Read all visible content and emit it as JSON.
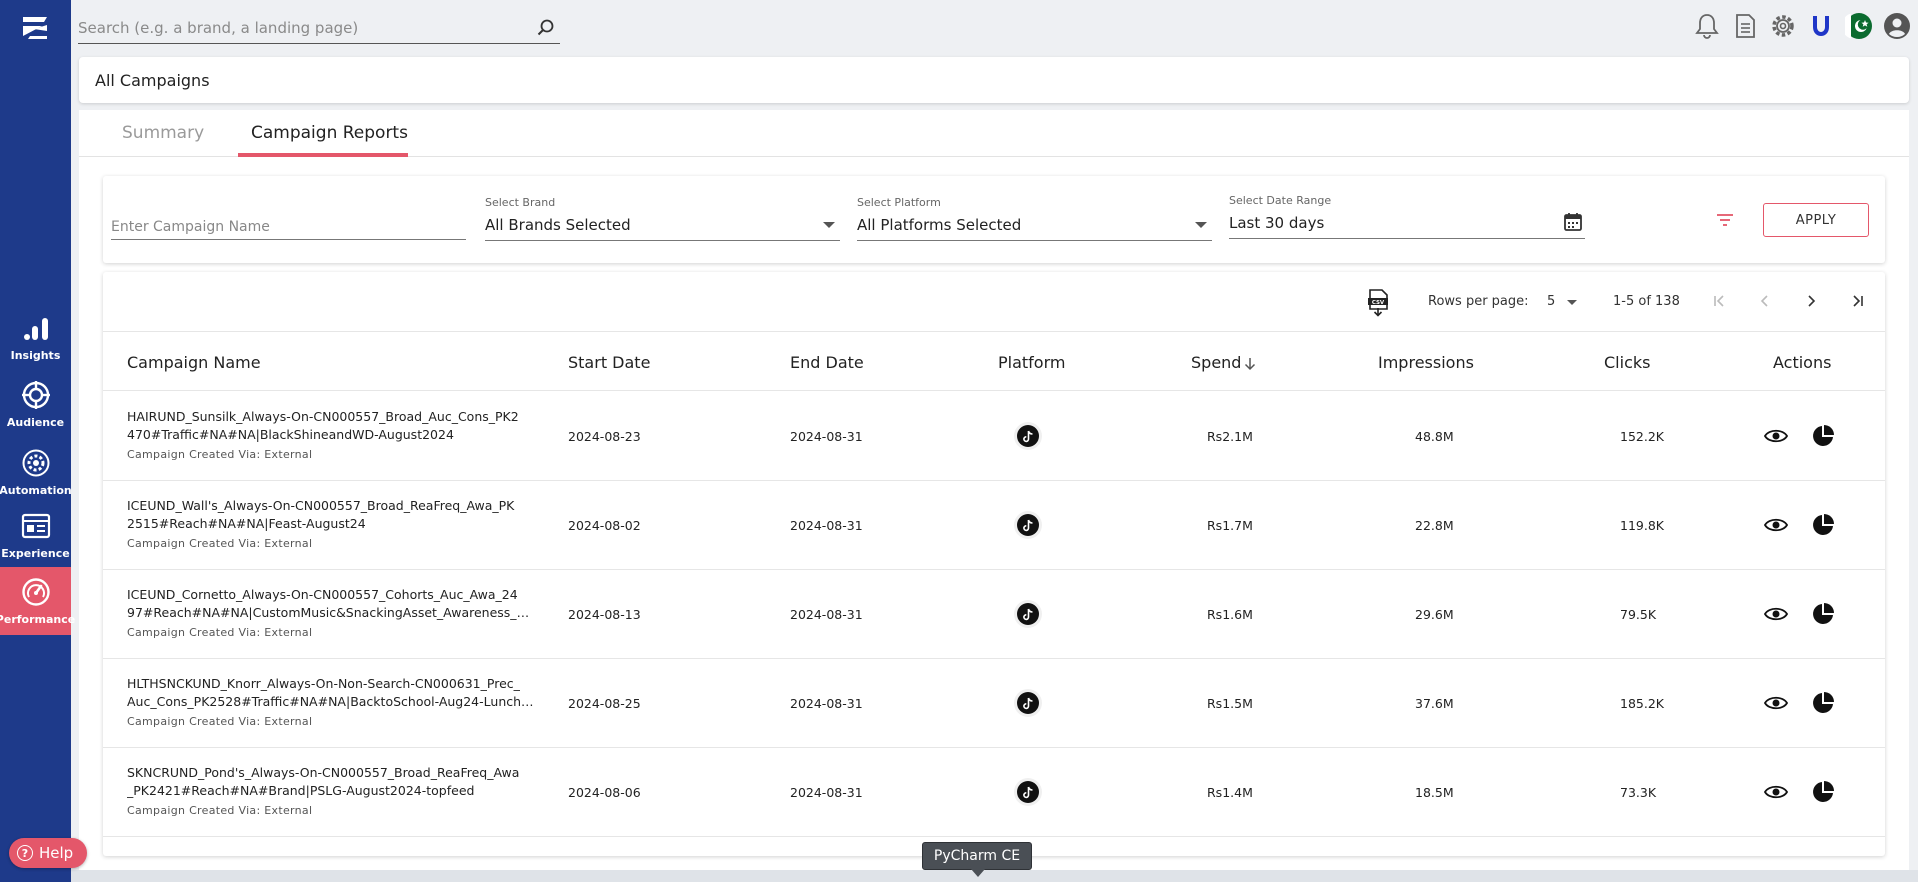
{
  "sidebar": {
    "items": [
      {
        "label": "Insights",
        "icon": "bar-chart-icon"
      },
      {
        "label": "Audience",
        "icon": "target-icon"
      },
      {
        "label": "Automation",
        "icon": "gear-icon"
      },
      {
        "label": "Experience",
        "icon": "newspaper-icon"
      },
      {
        "label": "Performance",
        "icon": "speedometer-icon",
        "active": true
      }
    ],
    "help_label": "Help"
  },
  "topbar": {
    "search_placeholder": "Search (e.g. a brand, a landing page)",
    "icons": [
      "bell-icon",
      "document-icon",
      "settings-icon",
      "unilever-logo-icon",
      "pakistan-flag-icon",
      "account-icon"
    ]
  },
  "header": {
    "title": "All Campaigns"
  },
  "tabs": [
    {
      "label": "Summary",
      "active": false
    },
    {
      "label": "Campaign Reports",
      "active": true
    }
  ],
  "filters": {
    "campaign_placeholder": "Enter Campaign Name",
    "brand": {
      "label": "Select Brand",
      "value": "All Brands Selected"
    },
    "platform": {
      "label": "Select Platform",
      "value": "All Platforms Selected"
    },
    "date": {
      "label": "Select Date Range",
      "value": "Last 30 days"
    },
    "apply_label": "APPLY"
  },
  "pagination": {
    "rows_per_page_label": "Rows per page:",
    "rows_per_page": "5",
    "range": "1-5 of 138"
  },
  "table": {
    "columns": [
      "Campaign Name",
      "Start Date",
      "End Date",
      "Platform",
      "Spend",
      "Impressions",
      "Clicks",
      "Actions"
    ],
    "sort_column": "Spend",
    "rows": [
      {
        "name_l1": "HAIRUND_Sunsilk_Always-On-CN000557_Broad_Auc_Cons_PK2",
        "name_l2": "470#Traffic#NA#NA|BlackShineandWD-August2024",
        "via": "Campaign Created Via: External",
        "start": "2024-08-23",
        "end": "2024-08-31",
        "platform": "tiktok",
        "spend": "Rs2.1M",
        "impressions": "48.8M",
        "clicks": "152.2K"
      },
      {
        "name_l1": "ICEUND_Wall's_Always-On-CN000557_Broad_ReaFreq_Awa_PK",
        "name_l2": "2515#Reach#NA#NA|Feast-August24",
        "via": "Campaign Created Via: External",
        "start": "2024-08-02",
        "end": "2024-08-31",
        "platform": "tiktok",
        "spend": "Rs1.7M",
        "impressions": "22.8M",
        "clicks": "119.8K"
      },
      {
        "name_l1": "ICEUND_Cornetto_Always-On-CN000557_Cohorts_Auc_Awa_24",
        "name_l2": "97#Reach#NA#NA|CustomMusic&SnackingAsset_Awareness_6se...",
        "via": "Campaign Created Via: External",
        "start": "2024-08-13",
        "end": "2024-08-31",
        "platform": "tiktok",
        "spend": "Rs1.6M",
        "impressions": "29.6M",
        "clicks": "79.5K"
      },
      {
        "name_l1": "HLTHSNCKUND_Knorr_Always-On-Non-Search-CN000631_Prec_",
        "name_l2": "Auc_Cons_PK2528#Traffic#NA#NA|BacktoSchool-Aug24-Lunchb...",
        "via": "Campaign Created Via: External",
        "start": "2024-08-25",
        "end": "2024-08-31",
        "platform": "tiktok",
        "spend": "Rs1.5M",
        "impressions": "37.6M",
        "clicks": "185.2K"
      },
      {
        "name_l1": "SKNCRUND_Pond's_Always-On-CN000557_Broad_ReaFreq_Awa",
        "name_l2": "_PK2421#Reach#NA#Brand|PSLG-August2024-topfeed",
        "via": "Campaign Created Via: External",
        "start": "2024-08-06",
        "end": "2024-08-31",
        "platform": "tiktok",
        "spend": "Rs1.4M",
        "impressions": "18.5M",
        "clicks": "73.3K"
      }
    ]
  },
  "tooltip": "PyCharm CE",
  "colors": {
    "sidebar": "#1e3a8a",
    "accent": "#e4576a"
  }
}
